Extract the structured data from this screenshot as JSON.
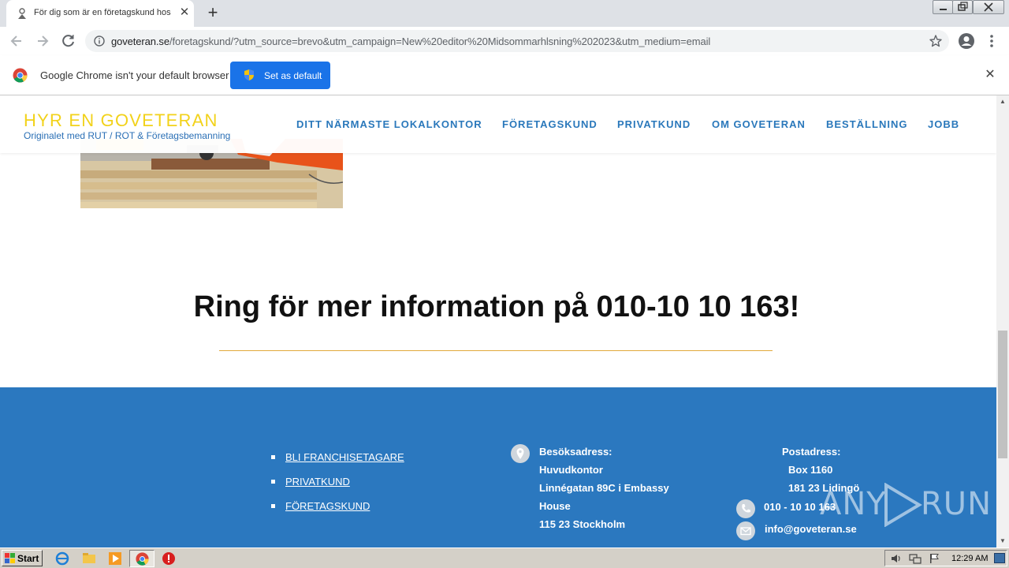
{
  "browser": {
    "tab": {
      "title": "För dig som är en företagskund hos",
      "close": "✕"
    },
    "new_tab": "+",
    "address": {
      "host": "goveteran.se",
      "path": "/foretagskund/?utm_source=brevo&utm_campaign=New%20editor%20Midsommarhlsning%202023&utm_medium=email"
    },
    "infobar": {
      "message": "Google Chrome isn't your default browser",
      "button": "Set as default",
      "close": "✕"
    }
  },
  "site": {
    "brand": "HYR EN GOVETERAN",
    "tagline": "Originalet med RUT / ROT & Företagsbemanning",
    "nav": [
      "DITT NÄRMASTE LOKALKONTOR",
      "FÖRETAGSKUND",
      "PRIVATKUND",
      "OM GOVETERAN",
      "BESTÄLLNING",
      "JOBB"
    ],
    "callout": "Ring för mer information på 010-10 10 163!",
    "footer": {
      "links": [
        "BLI FRANCHISETAGARE",
        "PRIVATKUND",
        "FÖRETAGSKUND"
      ],
      "visit_label": "Besöksadress:",
      "visit_lines": [
        "Huvudkontor",
        "Linnégatan 89C i Embassy",
        "House",
        "115 23 Stockholm"
      ],
      "post_label": "Postadress:",
      "post_lines": [
        "Box 1160",
        "181 23 Lidingö"
      ],
      "phone": "010 - 10 10 163",
      "email": "info@goveteran.se"
    },
    "watermark": {
      "left": "ANY",
      "right": "RUN"
    }
  },
  "colors": {
    "brand_yellow": "#f2d21a",
    "nav_blue": "#2a78bb",
    "footer_blue": "#2b78bf",
    "divider_orange": "#e2a93b",
    "chrome_button": "#1a73e8"
  },
  "taskbar": {
    "start": "Start",
    "clock": "12:29 AM"
  }
}
